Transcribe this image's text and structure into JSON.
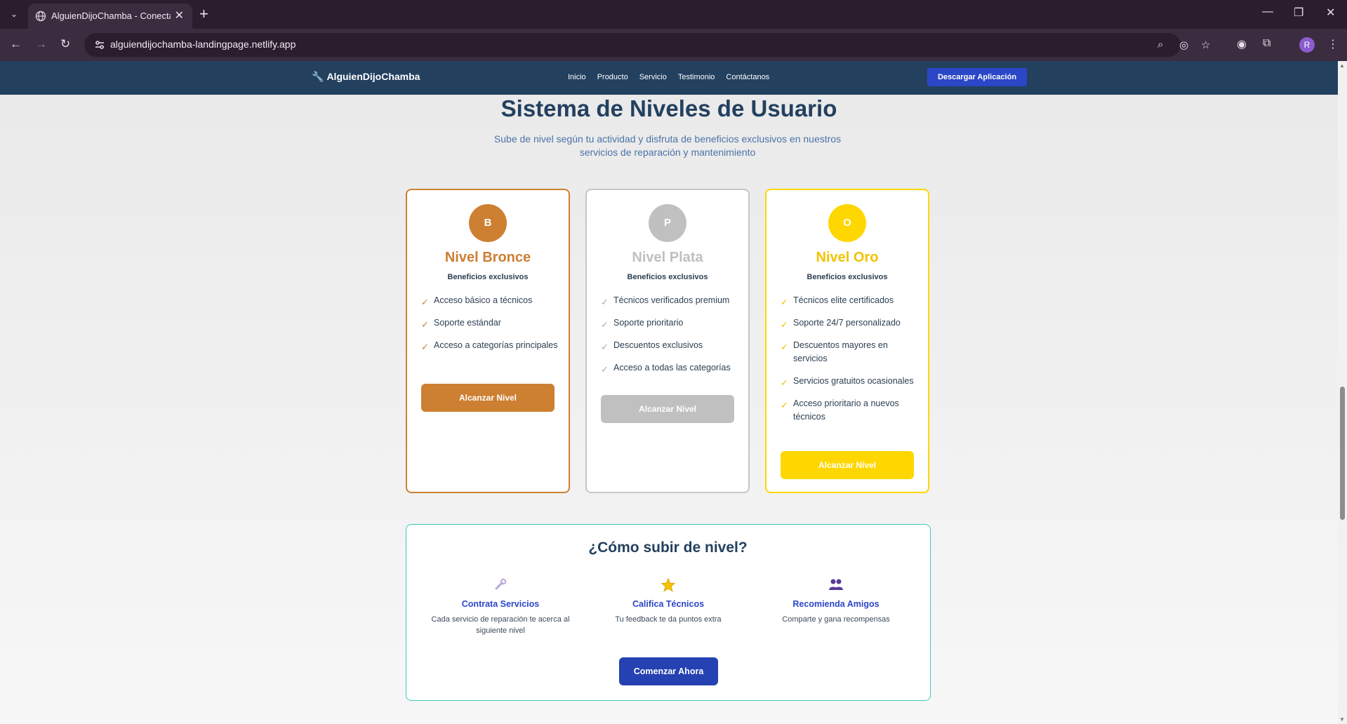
{
  "browser": {
    "tab_title": "AlguienDijoChamba - Conectan",
    "url": "alguiendijochamba-landingpage.netlify.app",
    "avatar_letter": "R"
  },
  "header": {
    "brand": "AlguienDijoChamba",
    "nav": [
      "Inicio",
      "Producto",
      "Servicio",
      "Testimonio",
      "Contáctanos"
    ],
    "cta": "Descargar Aplicación"
  },
  "section": {
    "title": "Sistema de Niveles de Usuario",
    "subtitle": "Sube de nivel según tu actividad y disfruta de beneficios exclusivos en nuestros servicios de reparación y mantenimiento"
  },
  "levels": [
    {
      "badge": "B",
      "name": "Nivel Bronce",
      "subtitle": "Beneficios exclusivos",
      "color": "#cd7f32",
      "benefits": [
        "Acceso básico a técnicos",
        "Soporte estándar",
        "Acceso a categorías principales"
      ],
      "button": "Alcanzar Nivel"
    },
    {
      "badge": "P",
      "name": "Nivel Plata",
      "subtitle": "Beneficios exclusivos",
      "color": "#c0c0c0",
      "benefits": [
        "Técnicos verificados premium",
        "Soporte prioritario",
        "Descuentos exclusivos",
        "Acceso a todas las categorías"
      ],
      "button": "Alcanzar Nivel"
    },
    {
      "badge": "O",
      "name": "Nivel Oro",
      "subtitle": "Beneficios exclusivos",
      "color": "#ffd700",
      "benefits": [
        "Técnicos elite certificados",
        "Soporte 24/7 personalizado",
        "Descuentos mayores en servicios",
        "Servicios gratuitos ocasionales",
        "Acceso prioritario a nuevos técnicos"
      ],
      "button": "Alcanzar Nivel"
    }
  ],
  "howto": {
    "title": "¿Cómo subir de nivel?",
    "steps": [
      {
        "icon": "wrench-icon",
        "title": "Contrata Servicios",
        "desc": "Cada servicio de reparación te acerca al siguiente nivel"
      },
      {
        "icon": "star-icon",
        "title": "Califica Técnicos",
        "desc": "Tu feedback te da puntos extra"
      },
      {
        "icon": "people-icon",
        "title": "Recomienda Amigos",
        "desc": "Comparte y gana recompensas"
      }
    ],
    "button": "Comenzar Ahora"
  }
}
